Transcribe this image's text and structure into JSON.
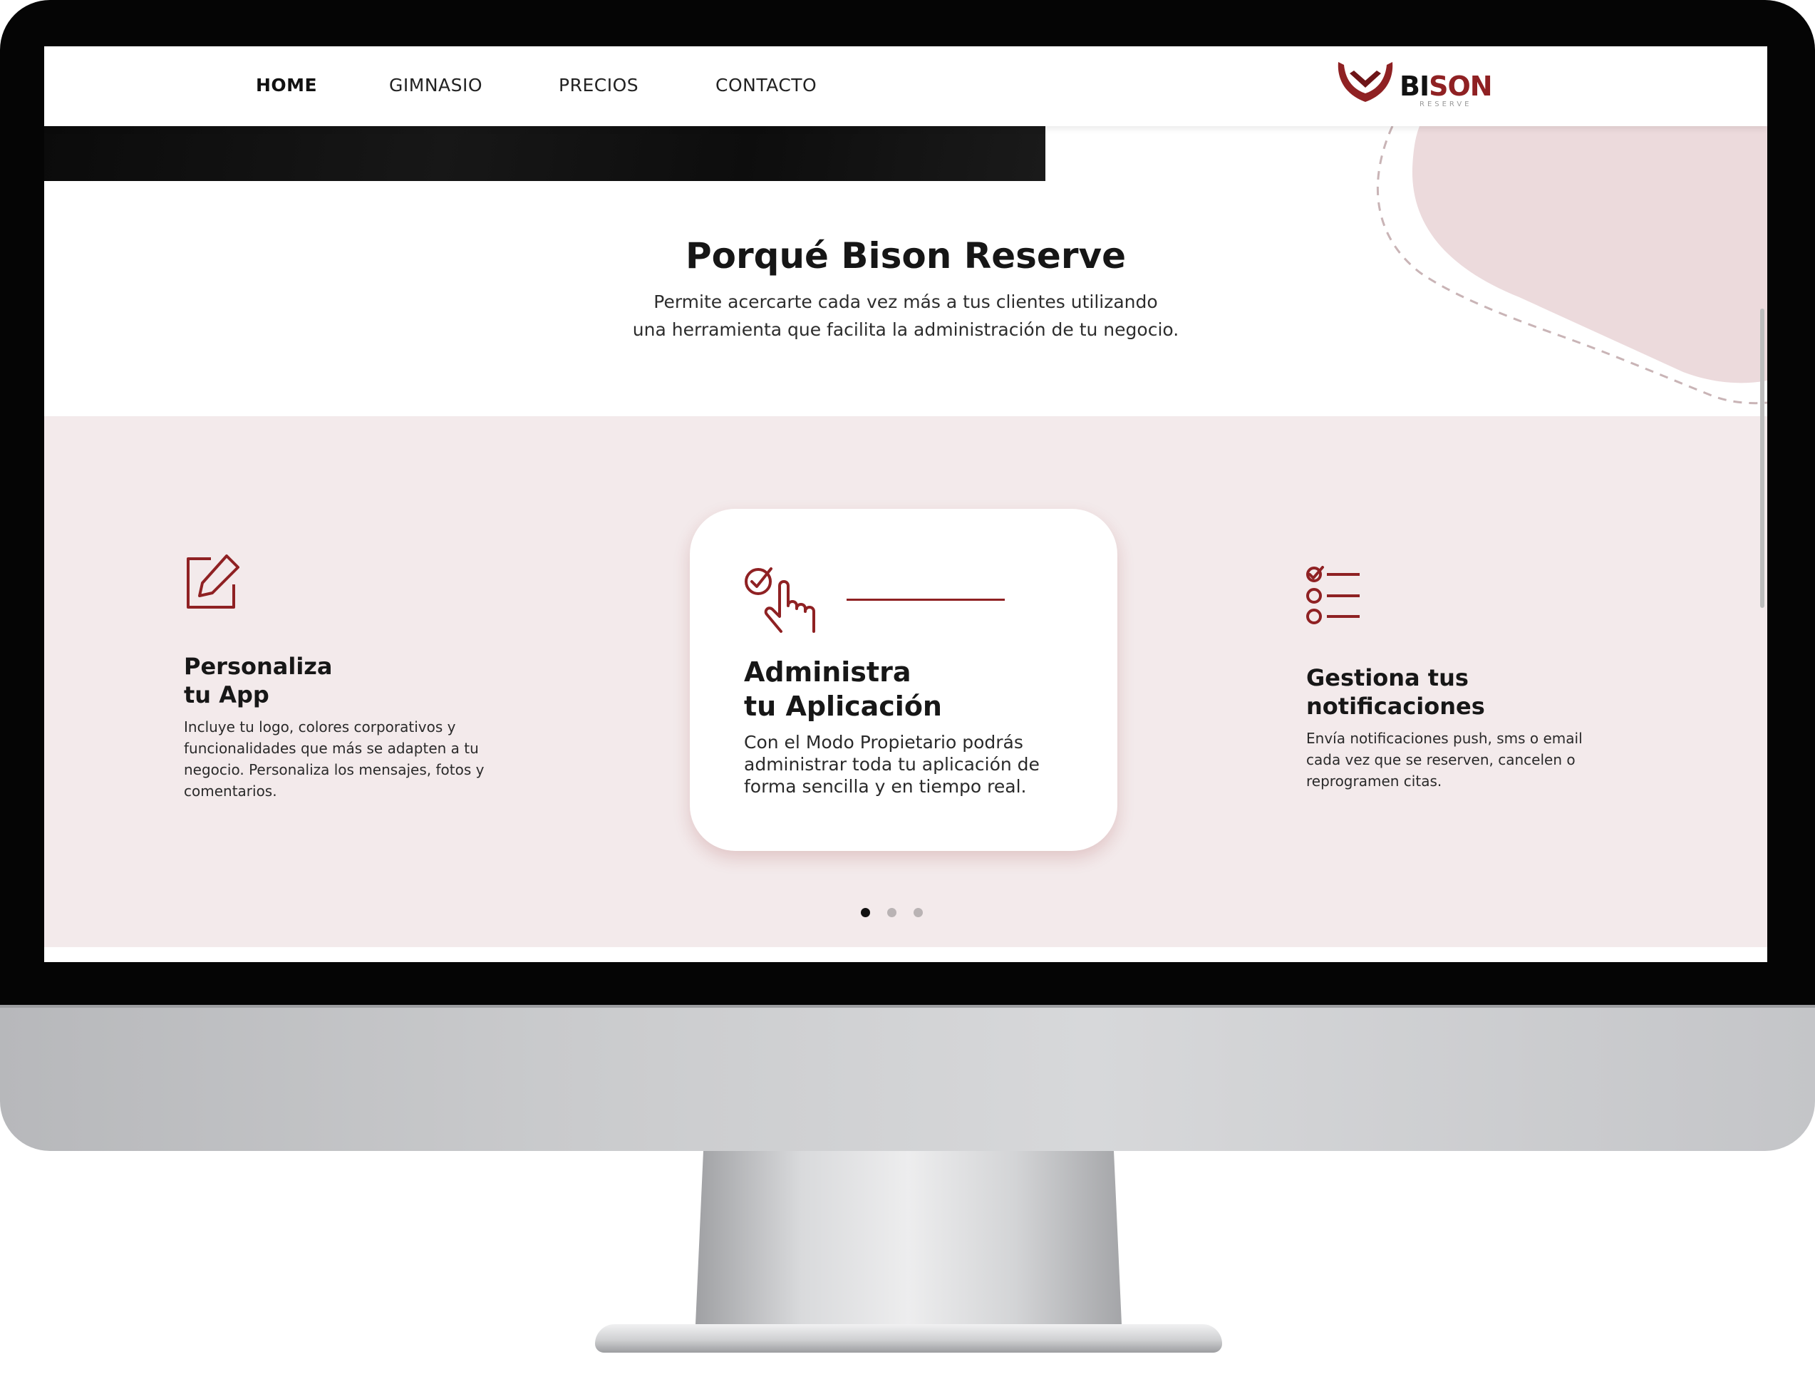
{
  "nav": {
    "items": [
      "HOME",
      "GIMNASIO",
      "PRECIOS",
      "CONTACTO"
    ],
    "active": "HOME"
  },
  "logo": {
    "part1": "BI",
    "part2": "SON",
    "tagline": "RESERVE"
  },
  "intro": {
    "title": "Porqué Bison Reserve",
    "line1": "Permite acercarte cada vez más a tus clientes utilizando",
    "line2": "una herramienta que facilita la administración de tu negocio."
  },
  "features": [
    {
      "icon": "edit-icon",
      "title_line1": "Personaliza",
      "title_line2": "tu App",
      "text_line1": "Incluye tu logo, colores corporativos y",
      "text_line2": "funcionalidades que más se adapten a tu",
      "text_line3": "negocio. Personaliza los mensajes, fotos y",
      "text_line4": "comentarios."
    },
    {
      "icon": "touch-check-icon",
      "title_line1": "Administra",
      "title_line2": "tu Aplicación",
      "text_line1": "Con el Modo Propietario podrás",
      "text_line2": "administrar toda tu aplicación de",
      "text_line3": "forma sencilla y en tiempo real."
    },
    {
      "icon": "checklist-icon",
      "title_line1": "Gestiona tus",
      "title_line2": "notificaciones",
      "text_line1": "Envía notificaciones push, sms o email",
      "text_line2": "cada vez que se reserven, cancelen o",
      "text_line3": "reprogramen citas."
    }
  ],
  "carousel": {
    "slides": 3,
    "active_index": 0
  },
  "colors": {
    "accent": "#8f2123",
    "section_bg": "#f3eaeb",
    "blob": "#ecdadc",
    "dot_active": "#111111",
    "dot_inactive": "#b9b3b4"
  }
}
